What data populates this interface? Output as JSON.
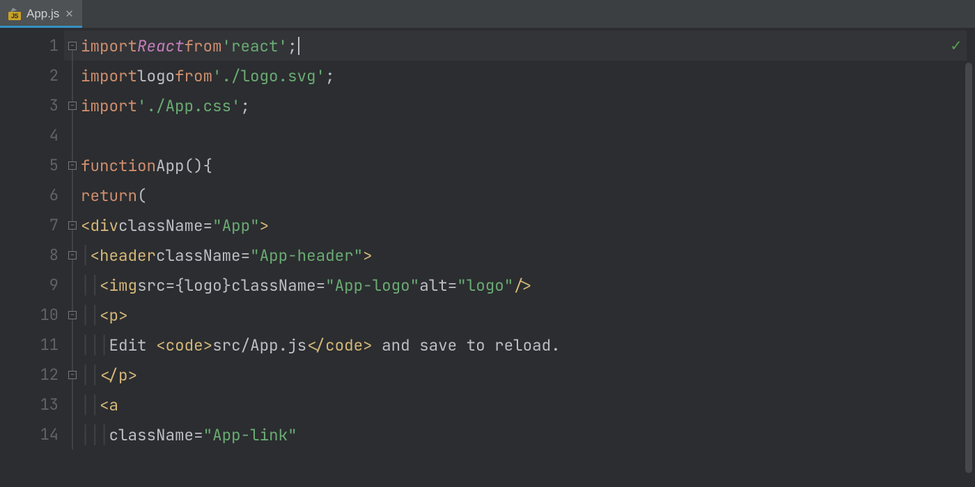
{
  "tab": {
    "filename": "App.js",
    "icon_label": "JS"
  },
  "lines": [
    "1",
    "2",
    "3",
    "4",
    "5",
    "6",
    "7",
    "8",
    "9",
    "10",
    "11",
    "12",
    "13",
    "14"
  ],
  "code": {
    "l1": {
      "kw1": "import",
      "react": "React",
      "kw2": "from",
      "str": "'react'",
      "semi": ";"
    },
    "l2": {
      "kw1": "import",
      "ident": "logo",
      "kw2": "from",
      "str": "'./logo.svg'",
      "semi": ";"
    },
    "l3": {
      "kw1": "import",
      "str": "'./App.css'",
      "semi": ";"
    },
    "l5": {
      "kw": "function",
      "name": "App",
      "paren": "()",
      "brace": "{"
    },
    "l6": {
      "kw": "return",
      "paren": "("
    },
    "l7": {
      "open": "<",
      "tag": "div",
      "attr": "className",
      "eq": "=",
      "val": "\"App\"",
      "close": ">"
    },
    "l8": {
      "open": "<",
      "tag": "header",
      "attr": "className",
      "eq": "=",
      "val": "\"App-header\"",
      "close": ">"
    },
    "l9": {
      "open": "<",
      "tag": "img",
      "a1": "src",
      "eq1": "=",
      "bo": "{",
      "v1": "logo",
      "bc": "}",
      "a2": "className",
      "eq2": "=",
      "v2": "\"App-logo\"",
      "a3": "alt",
      "eq3": "=",
      "v3": "\"logo\"",
      "close": "/>"
    },
    "l10": {
      "open": "<",
      "tag": "p",
      "close": ">"
    },
    "l11": {
      "t1": "Edit ",
      "co": "<",
      "ct": "code",
      "cc": ">",
      "path": "src/App.js",
      "eo": "</",
      "et": "code",
      "ec": ">",
      "t2": " and save to reload."
    },
    "l12": {
      "open": "</",
      "tag": "p",
      "close": ">"
    },
    "l13": {
      "open": "<",
      "tag": "a"
    },
    "l14": {
      "attr": "className",
      "eq": "=",
      "val": "\"App-link\""
    }
  },
  "status": {
    "check": "✓"
  }
}
